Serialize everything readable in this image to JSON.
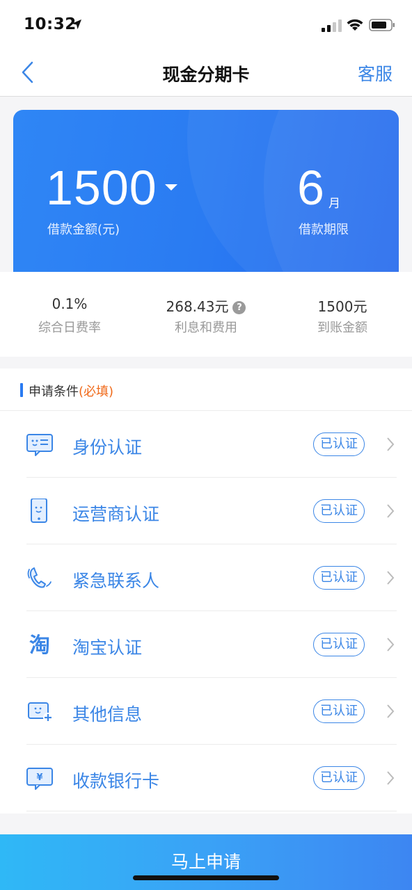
{
  "status_bar": {
    "time": "10:32"
  },
  "nav": {
    "title": "现金分期卡",
    "service_label": "客服"
  },
  "loan": {
    "amount": "1500",
    "amount_label": "借款金额(元)",
    "term": "6",
    "term_unit": "月",
    "term_label": "借款期限"
  },
  "fees": [
    {
      "value": "0.1%",
      "label": "综合日费率"
    },
    {
      "value": "268.43元",
      "label": "利息和费用",
      "help": "?"
    },
    {
      "value": "1500元",
      "label": "到账金额"
    }
  ],
  "conditions": {
    "header": "申请条件",
    "required_note": "(必填)",
    "items": [
      {
        "label": "身份认证",
        "status": "已认证",
        "icon": "id-card-icon"
      },
      {
        "label": "运营商认证",
        "status": "已认证",
        "icon": "phone-icon"
      },
      {
        "label": "紧急联系人",
        "status": "已认证",
        "icon": "contact-phone-icon"
      },
      {
        "label": "淘宝认证",
        "status": "已认证",
        "icon": "taobao-icon",
        "icon_text": "淘"
      },
      {
        "label": "其他信息",
        "status": "已认证",
        "icon": "other-info-icon"
      },
      {
        "label": "收款银行卡",
        "status": "已认证",
        "icon": "bank-card-icon",
        "icon_text": "¥"
      }
    ]
  },
  "apply_button": {
    "label": "马上申请"
  },
  "colors": {
    "accent": "#3b86e6",
    "card_blue": "#2a7bf2",
    "required_orange": "#f06a1a"
  }
}
